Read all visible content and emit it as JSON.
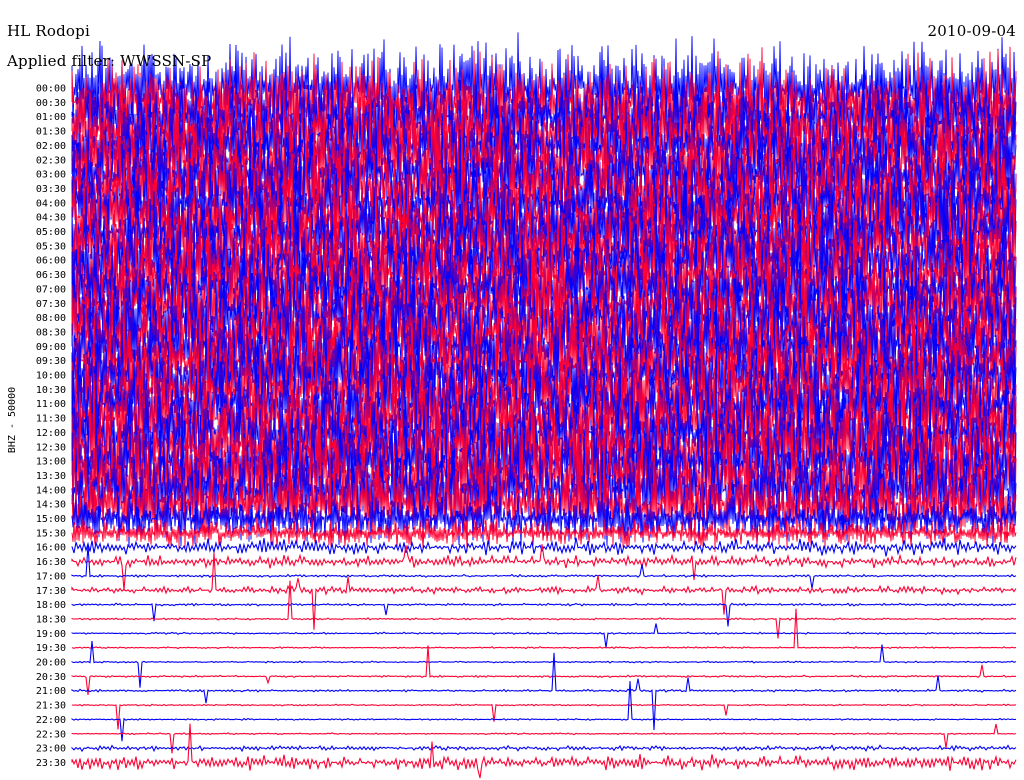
{
  "header": {
    "station": "HL Rodopi",
    "filter_label": "Applied filter: WWSSN-SP",
    "date": "2010-09-04"
  },
  "colors": {
    "trace_a": "#0000ff",
    "trace_b": "#ff0033",
    "background": "#ffffff",
    "text": "#000000"
  },
  "chart_data": {
    "type": "line",
    "title": "HL Rodopi",
    "subtitle": "Applied filter: WWSSN-SP",
    "date": "2010-09-04",
    "ylabel": "BHZ - 50000",
    "xlabel": "",
    "grid": false,
    "legend": "none",
    "x_range_minutes": [
      0,
      30
    ],
    "rows": [
      "00:00",
      "00:30",
      "01:00",
      "01:30",
      "02:00",
      "02:30",
      "03:00",
      "03:30",
      "04:00",
      "04:30",
      "05:00",
      "05:30",
      "06:00",
      "06:30",
      "07:00",
      "07:30",
      "08:00",
      "08:30",
      "09:00",
      "09:30",
      "10:00",
      "10:30",
      "11:00",
      "11:30",
      "12:00",
      "12:30",
      "13:00",
      "13:30",
      "14:00",
      "14:30",
      "15:00",
      "15:30",
      "16:00",
      "16:30",
      "17:00",
      "17:30",
      "18:00",
      "18:30",
      "19:00",
      "19:30",
      "20:00",
      "20:30",
      "21:00",
      "21:30",
      "22:00",
      "22:30",
      "23:00",
      "23:30"
    ],
    "trace_colors": [
      "#0000ff",
      "#ff0033"
    ],
    "relative_amplitude": [
      5.8,
      5.8,
      5.8,
      5.8,
      5.8,
      5.8,
      5.8,
      5.8,
      5.8,
      5.8,
      5.8,
      5.8,
      5.8,
      5.8,
      5.8,
      5.8,
      5.8,
      5.8,
      5.8,
      5.8,
      5.8,
      5.8,
      5.8,
      5.8,
      5.8,
      5.8,
      5.8,
      5.8,
      5.8,
      5.0,
      3.0,
      1.6,
      1.0,
      0.7,
      0.15,
      0.45,
      0.15,
      0.12,
      0.12,
      0.1,
      0.1,
      0.12,
      0.15,
      0.1,
      0.1,
      0.1,
      0.3,
      0.9
    ]
  }
}
